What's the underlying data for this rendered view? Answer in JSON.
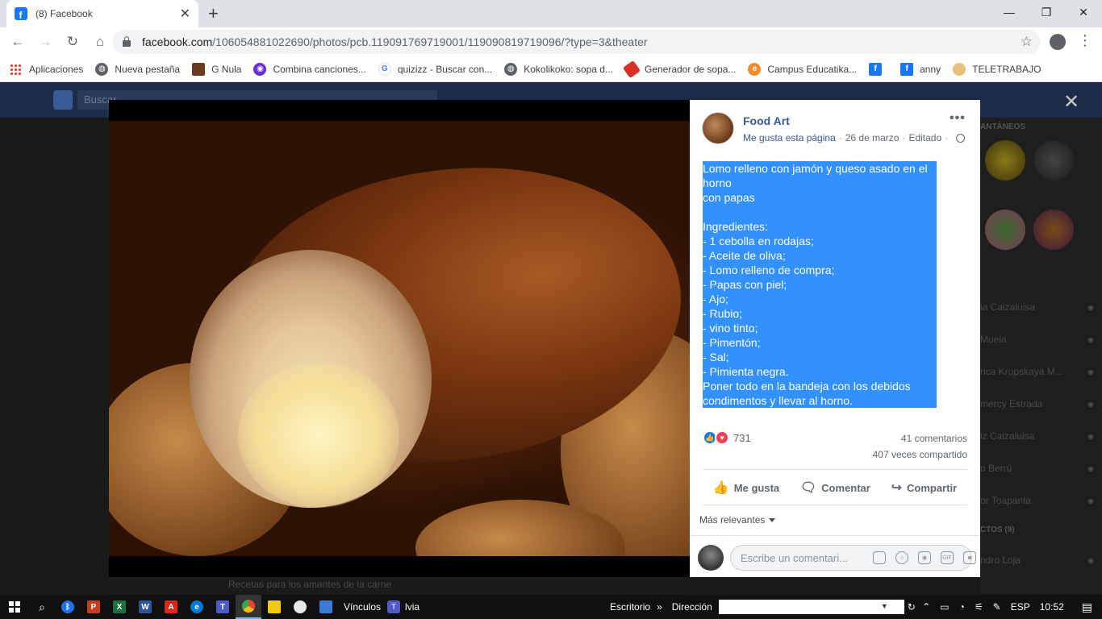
{
  "browser": {
    "tab_title": "(8) Facebook",
    "url_host": "facebook.com",
    "url_path": "/106054881022690/photos/pcb.119091769719001/119090819719096/?type=3&theater",
    "bookmarks": [
      {
        "label": "Aplicaciones",
        "icon": "apps-grid-icon"
      },
      {
        "label": "Nueva pestaña",
        "icon": "globe-icon"
      },
      {
        "label": "G Nula",
        "icon": "image-icon"
      },
      {
        "label": "Combina canciones...",
        "icon": "music-icon"
      },
      {
        "label": "quizizz - Buscar con...",
        "icon": "google-icon"
      },
      {
        "label": "Kokolikoko: sopa d...",
        "icon": "globe-icon"
      },
      {
        "label": "Generador de sopa...",
        "icon": "pencil-icon"
      },
      {
        "label": "Campus Educatika...",
        "icon": "campus-icon"
      },
      {
        "label": "",
        "icon": "facebook-icon"
      },
      {
        "label": "anny",
        "icon": "facebook-icon"
      },
      {
        "label": "TELETRABAJO",
        "icon": "person-icon"
      }
    ]
  },
  "background": {
    "search_text": "Buscar",
    "rail_header_1": "ANTÁNEOS",
    "rail_header_2": "CTOS (9)",
    "rail_people": [
      "ia Caizaluisa",
      "Muela",
      "rica Krupskaya M...",
      "mercy Estrada",
      "iz Caizaluisa",
      "o Berrú",
      "or Toapanta",
      "ndro Loja"
    ],
    "below_photo_text": "Recetas para los amantes de la carne"
  },
  "post": {
    "page_name": "Food Art",
    "like_page": "Me gusta esta página",
    "date": "26 de marzo",
    "edited": "Editado",
    "text_lines": [
      "Lomo relleno con jamón y queso asado en el horno",
      "con papas",
      " ",
      "Ingredientes:",
      "- 1 cebolla en rodajas;",
      "- Aceite de oliva;",
      "- Lomo relleno de compra;",
      "- Papas con piel;",
      "- Ajo;",
      "- Rubio;",
      "- vino tinto;",
      "- Pimentón;",
      "- Sal;",
      "- Pimienta negra.",
      "Poner todo en la bandeja con los debidos",
      "condimentos y llevar al horno."
    ],
    "reaction_count": "731",
    "comments_count": "41 comentarios",
    "shares_count": "407 veces compartido",
    "actions": {
      "like": "Me gusta",
      "comment": "Comentar",
      "share": "Compartir"
    },
    "sort_label": "Más relevantes",
    "comment_placeholder": "Escribe un comentari..."
  },
  "taskbar": {
    "links_label": "Vínculos",
    "teams_label": "lvia",
    "desktop_label": "Escritorio",
    "address_label": "Dirección",
    "language": "ESP",
    "time": "10:52"
  },
  "colors": {
    "facebook_blue": "#1877f2",
    "link_blue": "#385898",
    "selection": "#3390ff"
  }
}
